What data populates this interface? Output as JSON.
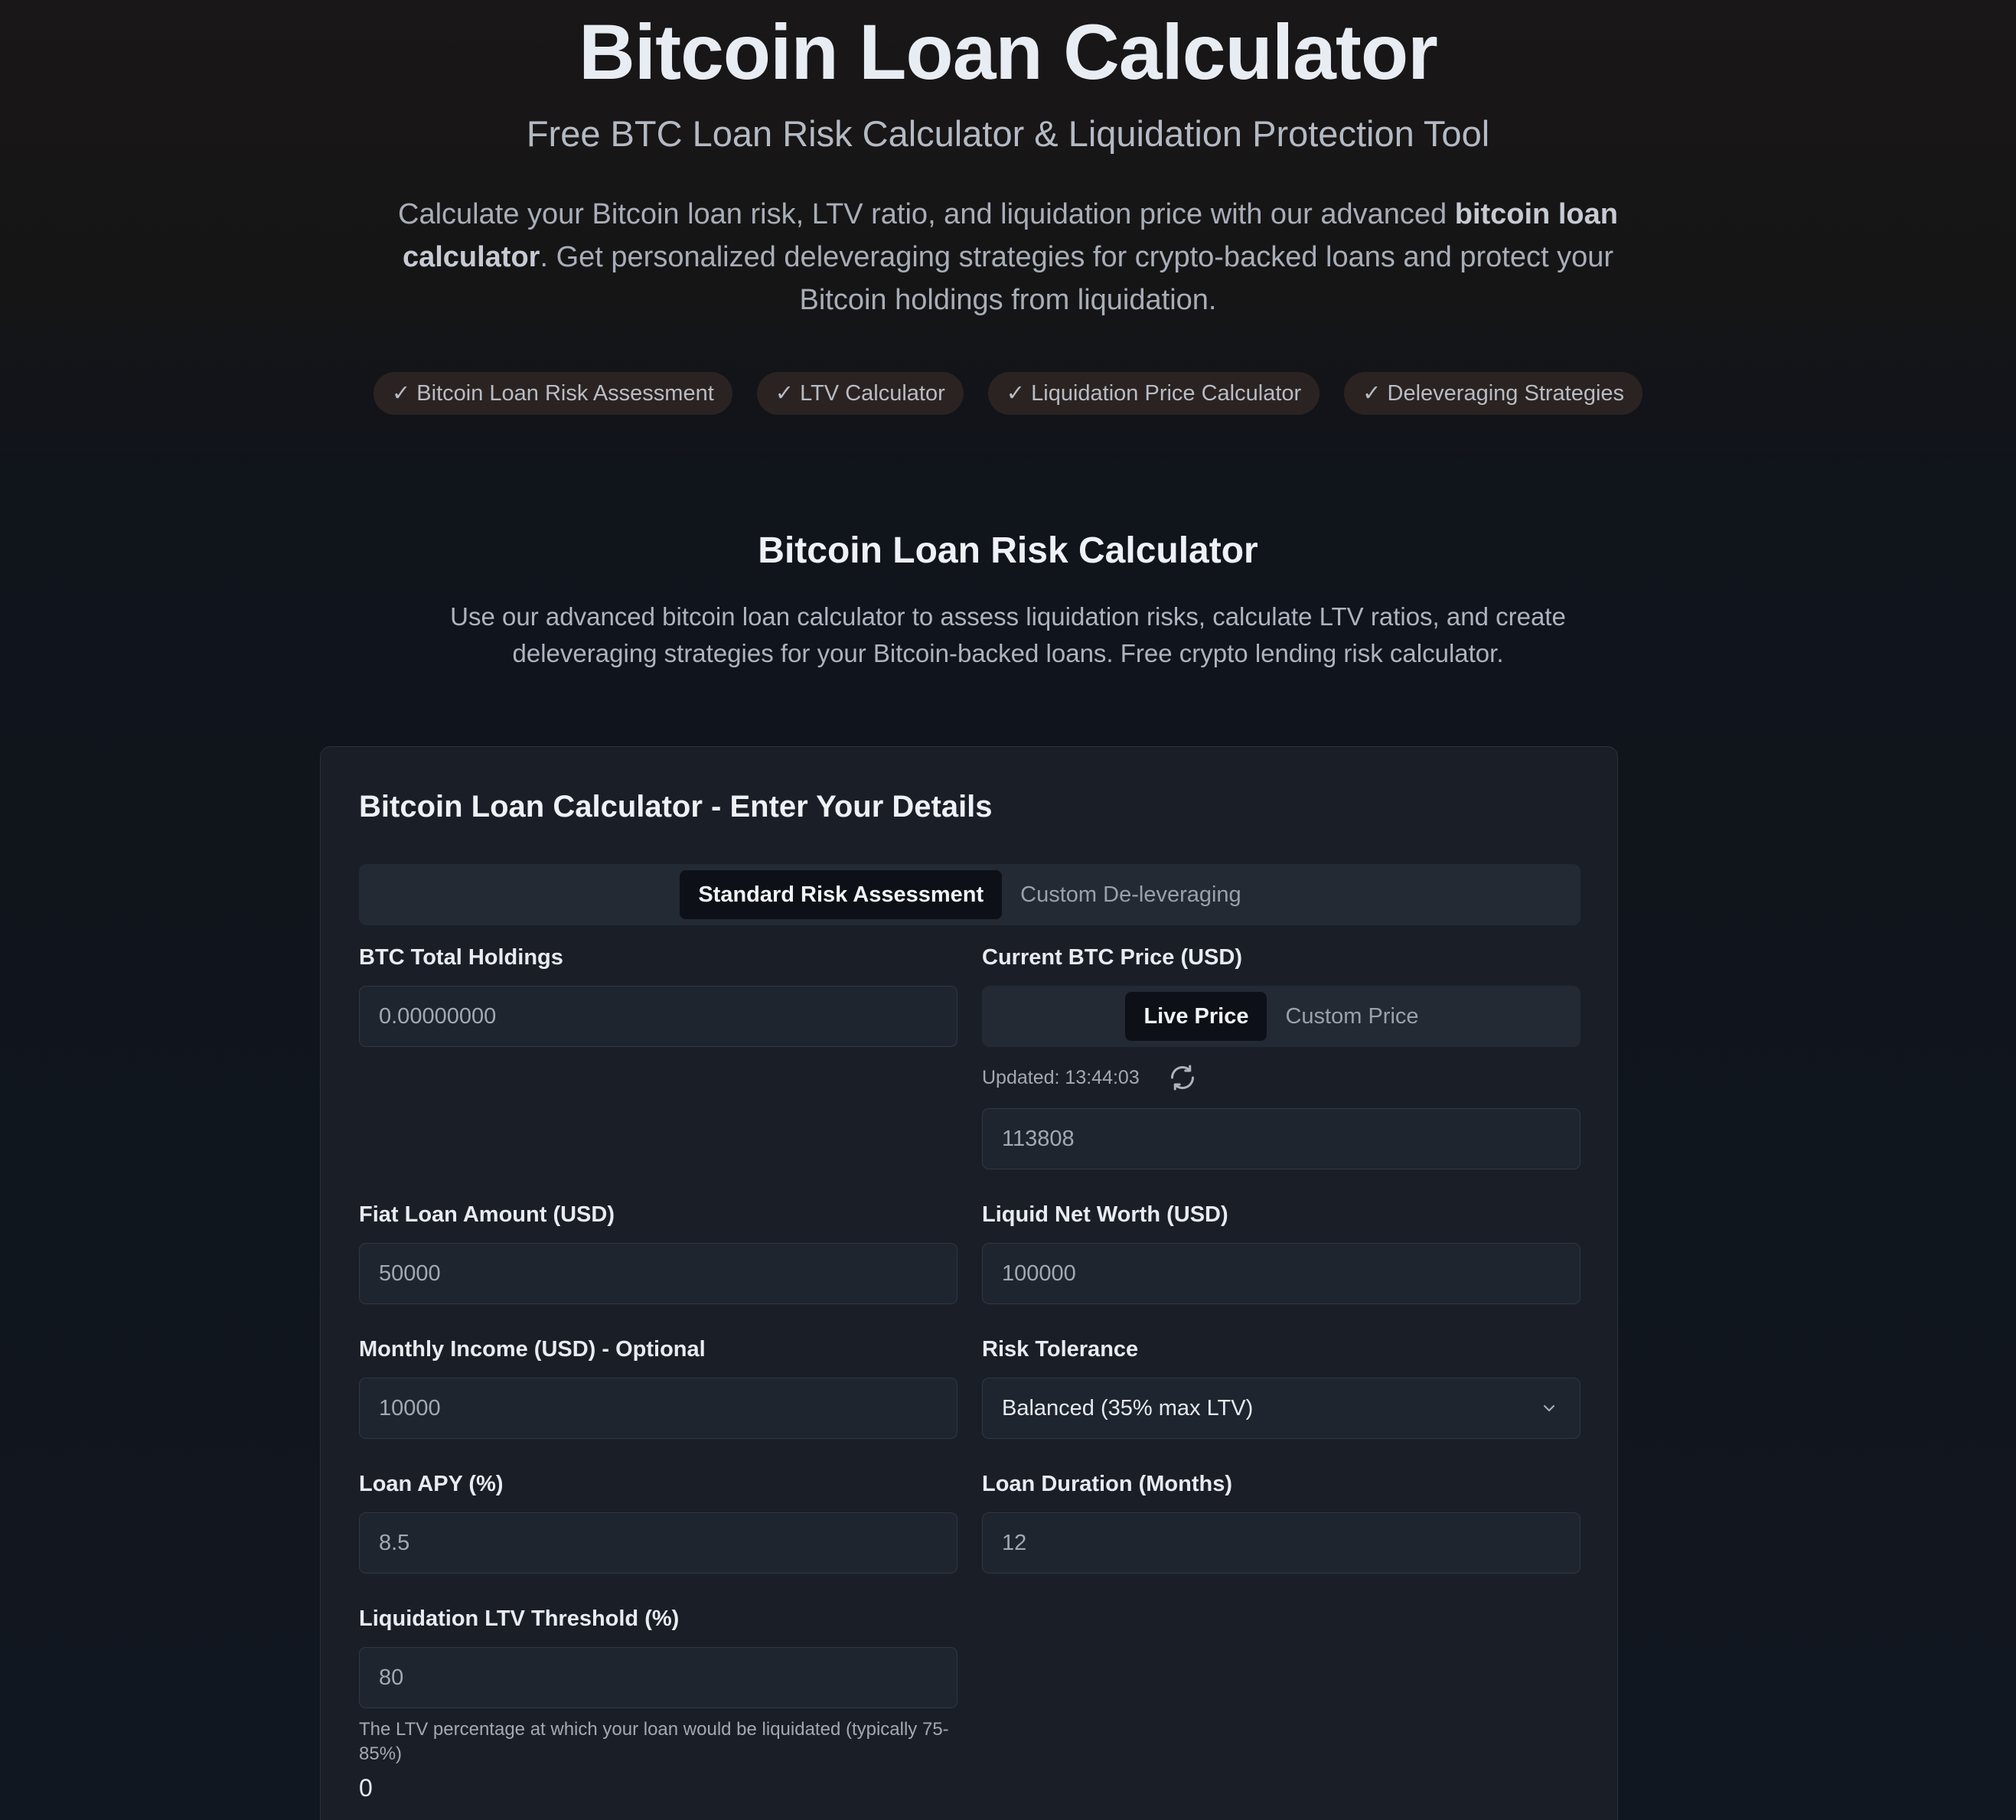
{
  "hero": {
    "title": "Bitcoin Loan Calculator",
    "subtitle": "Free BTC Loan Risk Calculator & Liquidation Protection Tool",
    "description_pre": "Calculate your Bitcoin loan risk, LTV ratio, and liquidation price with our advanced ",
    "description_bold": "bitcoin loan calculator",
    "description_post": ". Get personalized deleveraging strategies for crypto-backed loans and protect your Bitcoin holdings from liquidation.",
    "badges": [
      "✓ Bitcoin Loan Risk Assessment",
      "✓ LTV Calculator",
      "✓ Liquidation Price Calculator",
      "✓ Deleveraging Strategies"
    ]
  },
  "section": {
    "title": "Bitcoin Loan Risk Calculator",
    "description": "Use our advanced bitcoin loan calculator to assess liquidation risks, calculate LTV ratios, and create deleveraging strategies for your Bitcoin-backed loans. Free crypto lending risk calculator."
  },
  "form": {
    "title": "Bitcoin Loan Calculator - Enter Your Details",
    "mode_tabs": [
      "Standard Risk Assessment",
      "Custom De-leveraging"
    ],
    "active_mode": "Standard Risk Assessment",
    "btc_holdings": {
      "label": "BTC Total Holdings",
      "placeholder": "0.00000000"
    },
    "btc_price": {
      "label": "Current BTC Price (USD)",
      "tabs": [
        "Live Price",
        "Custom Price"
      ],
      "active_tab": "Live Price",
      "updated": "Updated: 13:44:03",
      "value": "113808"
    },
    "fiat_loan": {
      "label": "Fiat Loan Amount (USD)",
      "placeholder": "50000"
    },
    "net_worth": {
      "label": "Liquid Net Worth (USD)",
      "placeholder": "100000"
    },
    "monthly_income": {
      "label": "Monthly Income (USD) - Optional",
      "placeholder": "10000"
    },
    "risk_tolerance": {
      "label": "Risk Tolerance",
      "value": "Balanced (35% max LTV)"
    },
    "loan_apy": {
      "label": "Loan APY (%)",
      "placeholder": "8.5"
    },
    "loan_duration": {
      "label": "Loan Duration (Months)",
      "placeholder": "12"
    },
    "liquidation_ltv": {
      "label": "Liquidation LTV Threshold (%)",
      "placeholder": "80",
      "help": "The LTV percentage at which your loan would be liquidated (typically 75-85%)",
      "value": "0"
    }
  },
  "colors": {
    "background": "#111720",
    "card": "#1a1f27",
    "input": "#1f252e",
    "active_tab": "#0d1117",
    "badge": "#2b2322"
  },
  "icons": [
    "check-icon",
    "refresh-icon",
    "chevron-down-icon"
  ]
}
